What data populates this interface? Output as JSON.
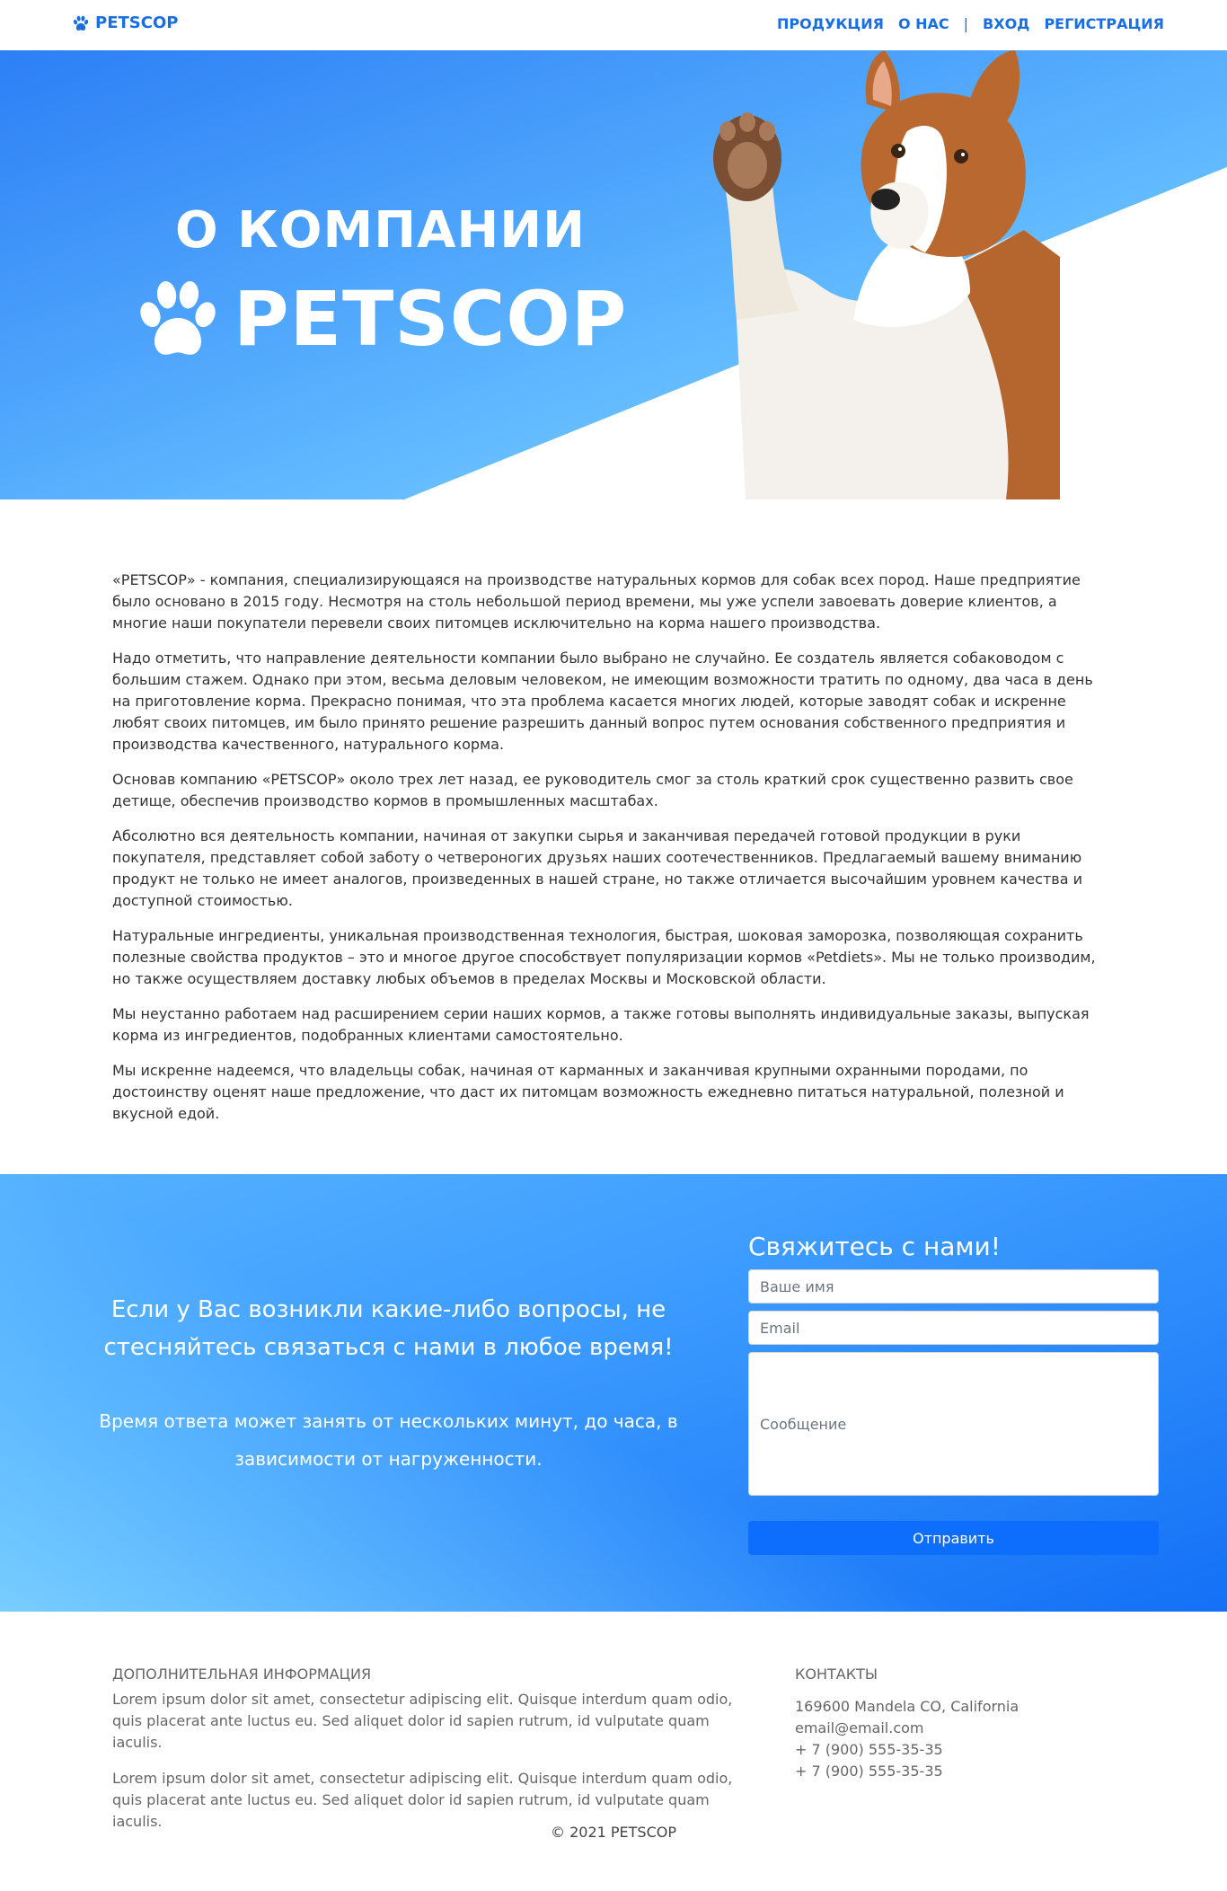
{
  "navbar": {
    "brand": "PETSCOP",
    "items": [
      "ПРОДУКЦИЯ",
      "О НАС",
      "ВХОД",
      "РЕГИСТРАЦИЯ"
    ],
    "separator": "|"
  },
  "hero": {
    "title": "О КОМПАНИИ",
    "brand": "PETSCOP"
  },
  "about": {
    "paragraphs": [
      "«PETSCOP» - компания, специализирующаяся на производстве натуральных кормов для собак всех пород. Наше предприятие было основано в 2015 году. Несмотря на столь небольшой период времени, мы уже успели завоевать доверие клиентов, а многие наши покупатели перевели своих питомцев исключительно на корма нашего производства.",
      "Надо отметить, что направление деятельности компании было выбрано не случайно. Ее создатель является собаководом с большим стажем. Однако при этом, весьма деловым человеком, не имеющим возможности тратить по одному, два часа в день на приготовление корма. Прекрасно понимая, что эта проблема касается многих людей, которые заводят собак и искренне любят своих питомцев, им было принято решение разрешить данный вопрос путем основания собственного предприятия и производства качественного, натурального корма.",
      "Основав компанию «PETSCOP» около трех лет назад, ее руководитель смог за столь краткий срок существенно развить свое детище, обеспечив производство кормов в промышленных масштабах.",
      "Абсолютно вся деятельность компании, начиная от закупки сырья и заканчивая передачей готовой продукции в руки покупателя, представляет собой заботу о четвероногих друзьях наших соотечественников. Предлагаемый вашему вниманию продукт не только не имеет аналогов, произведенных в нашей стране, но также отличается высочайшим уровнем качества и доступной стоимостью.",
      "Натуральные ингредиенты, уникальная производственная технология, быстрая, шоковая заморозка, позволяющая сохранить полезные свойства продуктов – это и многое другое способствует популяризации кормов «Petdiets». Мы не только производим, но также осуществляем доставку любых объемов в пределах Москвы и Московской области.",
      "Мы неустанно работаем над расширением серии наших кормов, а также готовы выполнять индивидуальные заказы, выпуская корма из ингредиентов, подобранных клиентами самостоятельно.",
      "Мы искренне надеемся, что владельцы собак, начиная от карманных и заканчивая крупными охранными породами, по достоинству оценят наше предложение, что даст их питомцам возможность ежедневно питаться натуральной, полезной и вкусной едой."
    ]
  },
  "contact": {
    "lead": "Если у Вас возникли какие-либо вопросы, не стесняйтесь связаться с нами в любое время!",
    "sub": "Время ответа может занять от нескольких минут, до часа, в зависимости от нагруженности.",
    "form_title": "Свяжитесь с нами!",
    "name_placeholder": "Ваше имя",
    "email_placeholder": "Email",
    "message_placeholder": "Сообщение",
    "submit_label": "Отправить"
  },
  "footer": {
    "info_heading": "ДОПОЛНИТЕЛЬНАЯ ИНФОРМАЦИЯ",
    "info_paragraphs": [
      "Lorem ipsum dolor sit amet, consectetur adipiscing elit. Quisque interdum quam odio, quis placerat ante luctus eu. Sed aliquet dolor id sapien rutrum, id vulputate quam iaculis.",
      "Lorem ipsum dolor sit amet, consectetur adipiscing elit. Quisque interdum quam odio, quis placerat ante luctus eu. Sed aliquet dolor id sapien rutrum, id vulputate quam iaculis."
    ],
    "contacts_heading": "КОНТАКТЫ",
    "contacts": [
      "169600 Mandela CO, California",
      "email@email.com",
      "+ 7 (900) 555-35-35",
      "+ 7 (900) 555-35-35"
    ],
    "copyright": "© 2021 PETSCOP"
  },
  "colors": {
    "brand": "#1a6fe0",
    "hero_blue": "#3d8ff5",
    "hero_light": "#7fd4ff",
    "button": "#0d6efd"
  }
}
